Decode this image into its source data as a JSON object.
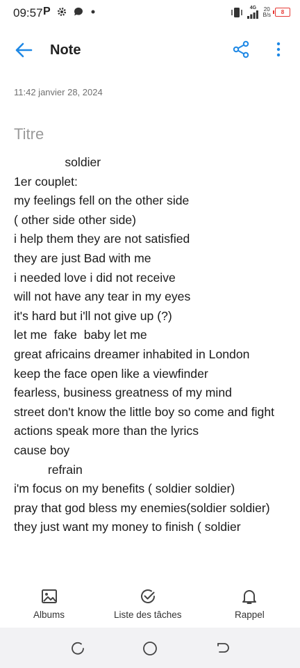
{
  "status_bar": {
    "time": "09:57",
    "net_speed_value": "20",
    "net_speed_unit": "B/s",
    "signal_label": "4G",
    "battery_level": "8",
    "left_icons": [
      "p-icon",
      "gear-icon",
      "chat-bubble-icon",
      "dot-icon"
    ],
    "right_icons": [
      "vibrate-icon",
      "signal-icon",
      "battery-icon"
    ]
  },
  "app_bar": {
    "title": "Note"
  },
  "note": {
    "date": "11:42 janvier 28, 2024",
    "title_placeholder": "Titre",
    "body": "               soldier\n1er couplet:\nmy feelings fell on the other side\n( other side other side)\ni help them they are not satisfied\nthey are just Bad with me\ni needed love i did not receive\nwill not have any tear in my eyes\nit's hard but i'll not give up (?)\nlet me  fake  baby let me\ngreat africains dreamer inhabited in London\nkeep the face open like a viewfinder\nfearless, business greatness of my mind\nstreet don't know the little boy so come and fight\nactions speak more than the lyrics\ncause boy\n          refrain\ni'm focus on my benefits ( soldier soldier)\npray that god bless my enemies(soldier soldier)\nthey just want my money to finish ( soldier"
  },
  "toolbar": {
    "albums_label": "Albums",
    "tasks_label": "Liste des tâches",
    "reminder_label": "Rappel"
  },
  "colors": {
    "accent": "#1e88e5",
    "battery_low": "#e53935",
    "nav_bg": "#f2f2f4"
  }
}
